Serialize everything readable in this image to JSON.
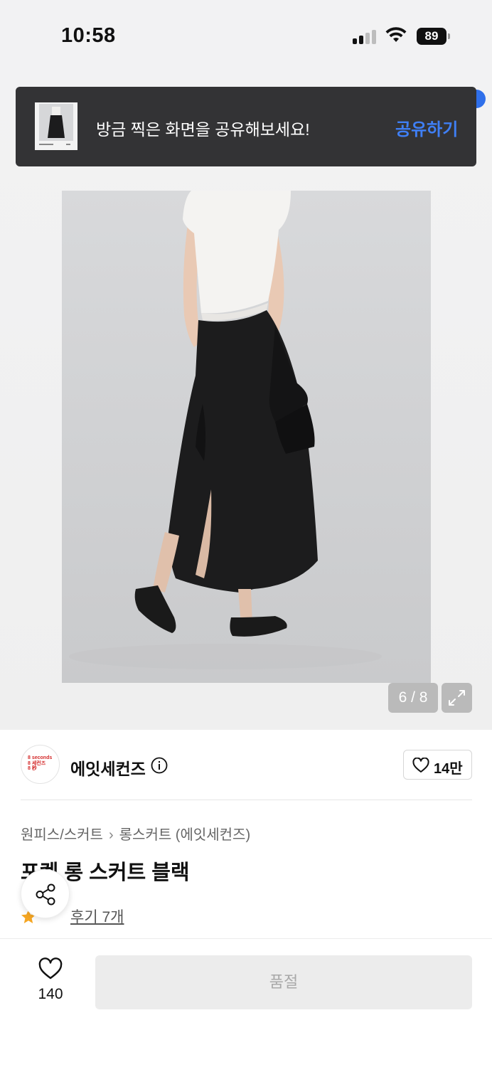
{
  "status_bar": {
    "time": "10:58",
    "battery": "89"
  },
  "toast": {
    "message": "방금 찍은 화면을 공유해보세요!",
    "action_label": "공유하기",
    "action_color": "#3f7ff5"
  },
  "gallery": {
    "counter": "6 / 8"
  },
  "brand": {
    "logo_text": "8 seconds\n8 세컨즈\n8 秒",
    "name": "에잇세컨즈",
    "like_count": "14만"
  },
  "product": {
    "breadcrumb": [
      "원피스/스커트",
      "롱스커트 (에잇세컨즈)"
    ],
    "title": "포켓 롱 스커트 블랙",
    "review_link": "후기 7개"
  },
  "bottom_bar": {
    "like_count": "140",
    "buy_label": "품절"
  },
  "icons": [
    "signal-icon",
    "wifi-icon",
    "battery-icon",
    "expand-icon",
    "info-icon",
    "heart-icon",
    "share-icon",
    "star-icon"
  ],
  "colors": {
    "accent": "#3f7ff5",
    "toast_bg": "#333335",
    "star": "#f5a623",
    "disabled_button": "#ececec"
  }
}
